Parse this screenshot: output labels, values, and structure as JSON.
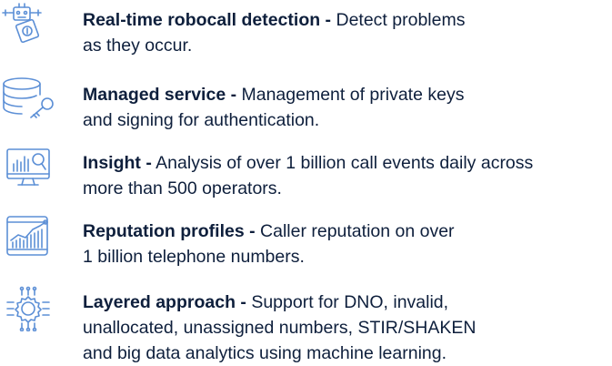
{
  "colors": {
    "text": "#0e1f3c",
    "icon_stroke": "#5c8fd6"
  },
  "features": [
    {
      "icon": "robot-dollar-icon",
      "title": "Real-time robocall detection -",
      "desc_lines": [
        "Detect problems",
        "as they occur."
      ]
    },
    {
      "icon": "database-key-icon",
      "title": "Managed service -",
      "desc_lines": [
        "Management of private keys",
        "and signing for authentication."
      ]
    },
    {
      "icon": "monitor-analytics-icon",
      "title": "Insight -",
      "desc_lines": [
        "Analysis of over 1 billion call events daily across",
        "more than 500 operators."
      ]
    },
    {
      "icon": "tablet-chart-icon",
      "title": "Reputation profiles -",
      "desc_lines": [
        "Caller reputation on over",
        "1 billion telephone numbers."
      ]
    },
    {
      "icon": "gear-circuit-icon",
      "title": "Layered approach -",
      "desc_lines": [
        "Support for DNO, invalid,",
        "unallocated, unassigned numbers, STIR/SHAKEN",
        "and big data analytics using machine learning."
      ]
    }
  ]
}
